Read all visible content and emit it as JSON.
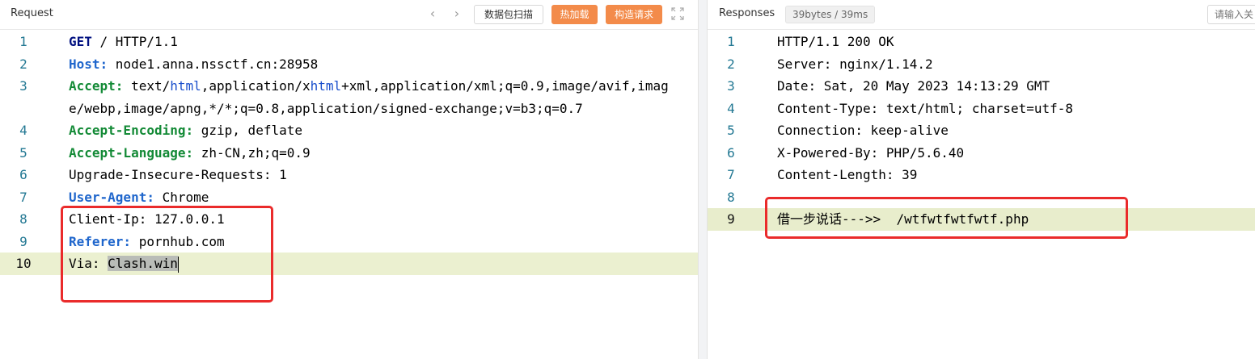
{
  "request": {
    "title": "Request",
    "nav_prev": "‹",
    "nav_next": "›",
    "scan_label": "数据包扫描",
    "hot_load_label": "热加载",
    "build_request_label": "构造请求",
    "lines": [
      {
        "num": "1",
        "key": "GET",
        "rest": " / HTTP/1.1"
      },
      {
        "num": "2",
        "key": "Host:",
        "rest": " node1.anna.nssctf.cn:28958"
      },
      {
        "num": "3",
        "key": "Accept:",
        "rest_a": " text/",
        "rest_html1": "html",
        "rest_b": ",application/x",
        "rest_html2": "html",
        "rest_c": "+xml,application/xml;q=0.9,image/avif,image/webp,image/apng,*/*;q=0.8,application/signed-exchange;v=b3;q=0.7"
      },
      {
        "num": "4",
        "key": "Accept-Encoding:",
        "rest": " gzip, deflate"
      },
      {
        "num": "5",
        "key": "Accept-Language:",
        "rest": " zh-CN,zh;q=0.9"
      },
      {
        "num": "6",
        "text": "Upgrade-Insecure-Requests: 1"
      },
      {
        "num": "7",
        "key": "User-Agent:",
        "rest": " Chrome"
      },
      {
        "num": "8",
        "text": "Client-Ip: 127.0.0.1"
      },
      {
        "num": "9",
        "key": "Referer:",
        "rest": " pornhub.com"
      },
      {
        "num": "10",
        "text_a": "Via: ",
        "text_sel": "Clash.win"
      }
    ]
  },
  "response": {
    "title": "Responses",
    "meta": "39bytes / 39ms",
    "search_placeholder": "请输入关",
    "lines": [
      {
        "num": "1",
        "text": "HTTP/1.1 200 OK"
      },
      {
        "num": "2",
        "text": "Server: nginx/1.14.2"
      },
      {
        "num": "3",
        "text": "Date: Sat, 20 May 2023 14:13:29 GMT"
      },
      {
        "num": "4",
        "text": "Content-Type: text/html; charset=utf-8"
      },
      {
        "num": "5",
        "text": "Connection: keep-alive"
      },
      {
        "num": "6",
        "text": "X-Powered-By: PHP/5.6.40"
      },
      {
        "num": "7",
        "text": "Content-Length: 39"
      },
      {
        "num": "8",
        "text": ""
      },
      {
        "num": "9",
        "text_cjk": "借一步说话",
        "text_rest": "--->>  /wtfwtfwtfwtf.php"
      }
    ]
  },
  "colors": {
    "accent_orange": "#f38b4a",
    "highlight_red": "#ea2b2b",
    "active_line": "#ebf0d0"
  }
}
